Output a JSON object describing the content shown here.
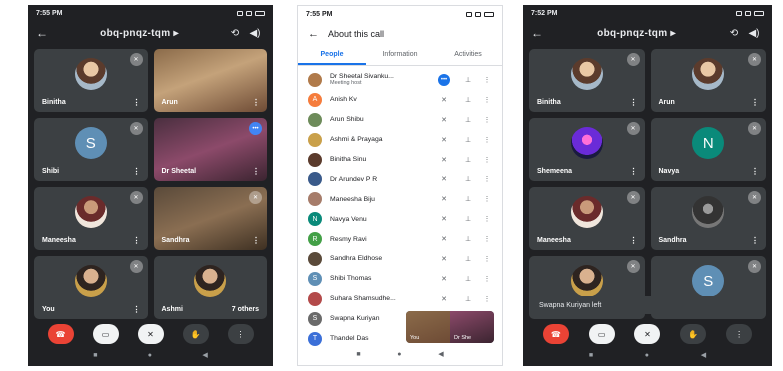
{
  "left_phone": {
    "status_time": "7:55 PM",
    "room": "obq-pnqz-tqm",
    "tiles": [
      {
        "name": "Binitha",
        "extra": ""
      },
      {
        "name": "Arun",
        "extra": ""
      },
      {
        "name": "Shibi",
        "extra": "",
        "initial": "S"
      },
      {
        "name": "Dr Sheetal",
        "extra": ""
      },
      {
        "name": "Maneesha",
        "extra": ""
      },
      {
        "name": "Sandhra",
        "extra": ""
      },
      {
        "name": "You",
        "extra": ""
      },
      {
        "name": "Ashmi",
        "extra": "7 others"
      }
    ]
  },
  "middle_phone": {
    "status_time": "7:55 PM",
    "title": "About this call",
    "tabs": [
      "People",
      "Information",
      "Activities"
    ],
    "participants": [
      {
        "name": "Dr Sheetal Sivanku...",
        "sub": "Meeting host",
        "initial": "",
        "color": "#b07a4a"
      },
      {
        "name": "Anish Kv",
        "sub": "",
        "initial": "A",
        "color": "#f57c3c"
      },
      {
        "name": "Arun Shibu",
        "sub": "",
        "initial": "",
        "color": "#6d8b5a"
      },
      {
        "name": "Ashmi & Prayaga",
        "sub": "",
        "initial": "",
        "color": "#c9a04a"
      },
      {
        "name": "Binitha Sinu",
        "sub": "",
        "initial": "",
        "color": "#5b3b2c"
      },
      {
        "name": "Dr Arundev P R",
        "sub": "",
        "initial": "",
        "color": "#3a5a8a"
      },
      {
        "name": "Maneesha Biju",
        "sub": "",
        "initial": "",
        "color": "#a67c6a"
      },
      {
        "name": "Navya Venu",
        "sub": "",
        "initial": "N",
        "color": "#0a8a7a"
      },
      {
        "name": "Resmy Ravi",
        "sub": "",
        "initial": "R",
        "color": "#43a047"
      },
      {
        "name": "Sandhra Eldhose",
        "sub": "",
        "initial": "",
        "color": "#5a4a3a"
      },
      {
        "name": "Shibi Thomas",
        "sub": "",
        "initial": "S",
        "color": "#5f8fb5"
      },
      {
        "name": "Suhara Shamsudhe...",
        "sub": "",
        "initial": "",
        "color": "#b34a4a"
      },
      {
        "name": "Swapna Kuriyan",
        "sub": "",
        "initial": "S",
        "color": "#6a6a6a"
      },
      {
        "name": "Thandel Das",
        "sub": "",
        "initial": "T",
        "color": "#3b6fd8"
      }
    ],
    "pip_labels": [
      "You",
      "Dr She"
    ]
  },
  "right_phone": {
    "status_time": "7:52 PM",
    "room": "obq-pnqz-tqm",
    "tiles": [
      {
        "name": "Binitha"
      },
      {
        "name": "Arun"
      },
      {
        "name": "Shemeena"
      },
      {
        "name": "Navya",
        "initial": "N"
      },
      {
        "name": "Maneesha"
      },
      {
        "name": "Sandhra"
      },
      {
        "name": ""
      },
      {
        "name": "",
        "initial": "S"
      }
    ],
    "snackbar": "Swapna Kuriyan left"
  },
  "icons": {
    "back": "←",
    "dropdown": "▸",
    "rotate": "⟲",
    "speaker": "◀)",
    "mic_off": "✕",
    "more": "⋮",
    "pin": "⊥",
    "end_call": "☎",
    "hand": "✋",
    "nav_back": "◀",
    "nav_home": "●",
    "nav_recent": "■"
  }
}
